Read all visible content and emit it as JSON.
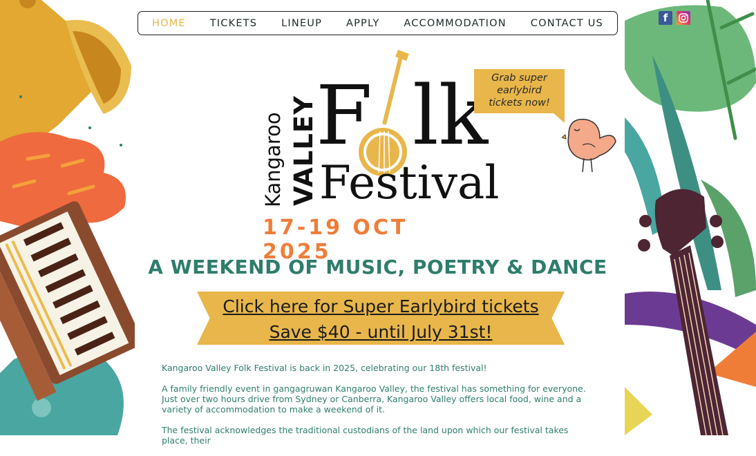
{
  "nav": {
    "items": [
      {
        "label": "HOME",
        "active": true
      },
      {
        "label": "TICKETS",
        "active": false
      },
      {
        "label": "LINEUP",
        "active": false
      },
      {
        "label": "APPLY",
        "active": false
      },
      {
        "label": "ACCOMMODATION",
        "active": false
      },
      {
        "label": "CONTACT US",
        "active": false
      }
    ]
  },
  "social": {
    "facebook_icon": "f",
    "instagram_icon": "instagram-icon"
  },
  "logo": {
    "kangaroo": "Kangaroo",
    "valley": "VALLEY",
    "folk_f": "F",
    "folk_lk": "lk",
    "festival": "Festival"
  },
  "dates": "17-19 OCT 2025",
  "bubble": {
    "line1": "Grab super",
    "line2": "earlybird",
    "line3": "tickets now!"
  },
  "tagline": "A WEEKEND OF MUSIC, POETRY & DANCE",
  "ribbon": {
    "line1": "Click here for Super Earlybird tickets",
    "line2": "Save $40 - until July 31st!"
  },
  "body": {
    "p1": "Kangaroo Valley Folk Festival is back in 2025, celebrating our 18th festival!",
    "p2": "A family friendly event in gangagruwan Kangaroo Valley,  the festival has something for everyone. Just over two hours drive from Sydney or Canberra, Kangaroo Valley offers local food, wine and a variety of accommodation to make a weekend of it.",
    "p3": "The festival acknowledges the traditional custodians of the land upon which our festival takes place, their"
  },
  "colors": {
    "accent_yellow": "#e8b64a",
    "teal": "#2f7d6c",
    "orange": "#ef7d38",
    "text_dark": "#1d2b2a"
  }
}
